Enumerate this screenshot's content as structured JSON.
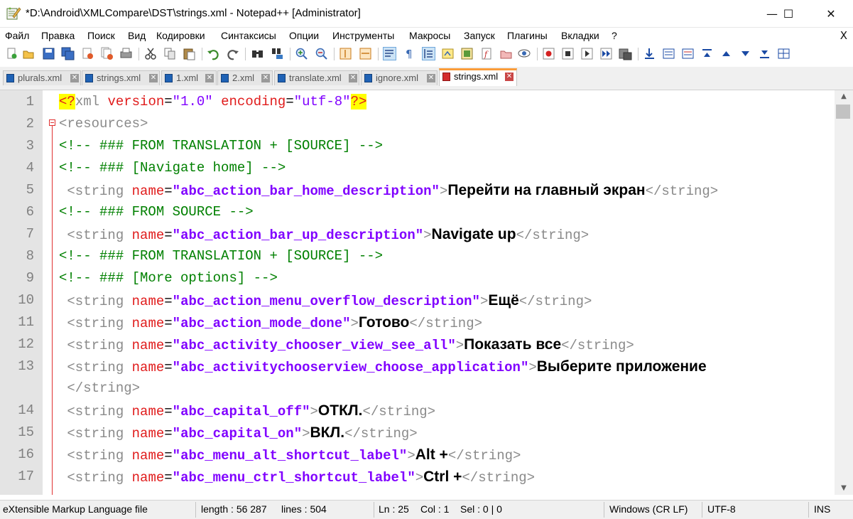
{
  "window": {
    "title": "*D:\\Android\\XMLCompare\\DST\\strings.xml - Notepad++ [Administrator]",
    "minimize_glyph": "—",
    "maximize_glyph": "☐",
    "close_glyph": "✕"
  },
  "menu": {
    "items": [
      "Файл",
      "Правка",
      "Поиск",
      "Вид",
      "Кодировки",
      "Синтаксисы",
      "Опции",
      "Инструменты",
      "Макросы",
      "Запуск",
      "Плагины",
      "Вкладки",
      "?"
    ],
    "close_glyph": "X"
  },
  "toolbar": {
    "icons": [
      "new-file-icon",
      "open-file-icon",
      "save-icon",
      "save-all-icon",
      "close-icon",
      "close-all-icon",
      "print-icon",
      "cut-icon",
      "copy-icon",
      "paste-icon",
      "undo-icon",
      "redo-icon",
      "find-icon",
      "replace-icon",
      "zoom-in-icon",
      "zoom-out-icon",
      "sync-vertical-icon",
      "sync-horizontal-icon",
      "word-wrap-icon",
      "show-all-chars-icon",
      "indent-guide-icon",
      "udl-icon",
      "doc-map-icon",
      "function-list-icon",
      "folder-workspace-icon",
      "monitoring-icon",
      "record-macro-icon",
      "stop-record-icon",
      "play-macro-icon",
      "run-macro-multiple-icon",
      "save-macro-icon",
      "plugin-1-icon",
      "plugin-2-icon",
      "plugin-3-icon",
      "plugin-4-icon",
      "plugin-5-icon",
      "plugin-6-icon",
      "plugin-7-icon",
      "plugin-8-icon"
    ]
  },
  "tabs": [
    {
      "label": "plurals.xml",
      "active": false
    },
    {
      "label": "strings.xml",
      "active": false
    },
    {
      "label": "1.xml",
      "active": false
    },
    {
      "label": "2.xml",
      "active": false
    },
    {
      "label": "translate.xml",
      "active": false
    },
    {
      "label": "ignore.xml",
      "active": false
    },
    {
      "label": "strings.xml",
      "active": true
    }
  ],
  "editor": {
    "lines": [
      {
        "num": "1",
        "kind": "decl",
        "version": "1.0",
        "encoding": "utf-8"
      },
      {
        "num": "2",
        "kind": "open",
        "tag": "resources"
      },
      {
        "num": "3",
        "kind": "comment",
        "text": "<!-- ### FROM TRANSLATION + [SOURCE] -->"
      },
      {
        "num": "4",
        "kind": "comment",
        "text": "<!-- ### [Navigate home] -->"
      },
      {
        "num": "5",
        "kind": "string",
        "name": "abc_action_bar_home_description",
        "value": "Перейти на главный экран"
      },
      {
        "num": "6",
        "kind": "comment",
        "text": "<!-- ### FROM SOURCE -->"
      },
      {
        "num": "7",
        "kind": "string",
        "name": "abc_action_bar_up_description",
        "value": "Navigate up"
      },
      {
        "num": "8",
        "kind": "comment",
        "text": "<!-- ### FROM TRANSLATION + [SOURCE] -->"
      },
      {
        "num": "9",
        "kind": "comment",
        "text": "<!-- ### [More options] -->"
      },
      {
        "num": "10",
        "kind": "string",
        "name": "abc_action_menu_overflow_description",
        "value": "Ещё"
      },
      {
        "num": "11",
        "kind": "string",
        "name": "abc_action_mode_done",
        "value": "Готово"
      },
      {
        "num": "12",
        "kind": "string",
        "name": "abc_activity_chooser_view_see_all",
        "value": "Показать все"
      },
      {
        "num": "13",
        "kind": "string-wrap",
        "name": "abc_activitychooserview_choose_application",
        "value": "Выберите приложение"
      },
      {
        "num": "14",
        "kind": "string",
        "name": "abc_capital_off",
        "value": "ОТКЛ."
      },
      {
        "num": "15",
        "kind": "string",
        "name": "abc_capital_on",
        "value": "ВКЛ."
      },
      {
        "num": "16",
        "kind": "string",
        "name": "abc_menu_alt_shortcut_label",
        "value": "Alt +"
      },
      {
        "num": "17",
        "kind": "string",
        "name": "abc_menu_ctrl_shortcut_label",
        "value": "Ctrl +"
      }
    ]
  },
  "status": {
    "file_type": "eXtensible Markup Language file",
    "length": "length : 56 287",
    "lines": "lines : 504",
    "ln": "Ln : 25",
    "col": "Col : 1",
    "sel": "Sel : 0 | 0",
    "eol": "Windows (CR LF)",
    "encoding": "UTF-8",
    "mode": "INS"
  }
}
